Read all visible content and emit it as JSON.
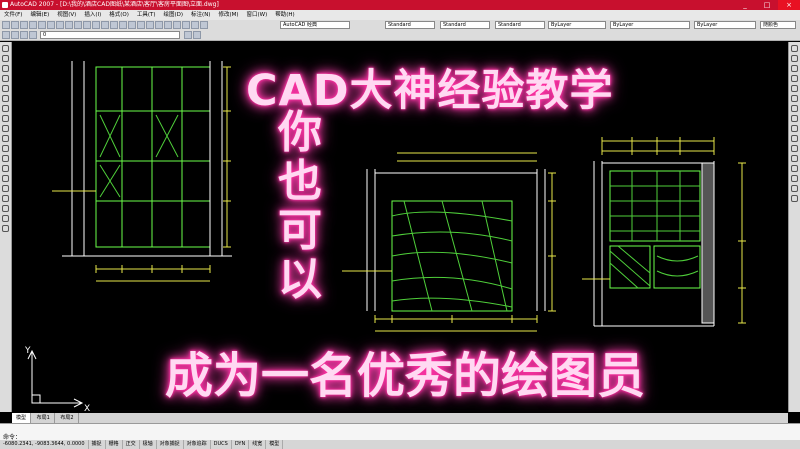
{
  "window": {
    "title": "AutoCAD 2007 - [D:\\我的\\酒店CAD图纸\\某酒店\\客厅\\客房平面图\\立面.dwg]",
    "minimize": "_",
    "maximize": "□",
    "close": "×"
  },
  "menu": [
    "文件(F)",
    "编辑(E)",
    "视图(V)",
    "插入(I)",
    "格式(O)",
    "工具(T)",
    "绘图(D)",
    "标注(N)",
    "修改(M)",
    "窗口(W)",
    "帮助(H)"
  ],
  "toolbar": {
    "workspace": "AutoCAD 经典",
    "text_style": "Standard",
    "dim_style": "Standard",
    "table_style": "Standard",
    "layer_color": "ByLayer",
    "linetype": "ByLayer",
    "lineweight": "ByLayer",
    "plot_style": "随颜色",
    "layer_name": "0"
  },
  "overlay": {
    "title": "CAD大神经验教学",
    "vertical": [
      "你",
      "也",
      "可",
      "以"
    ],
    "subtitle": "成为一名优秀的绘图员"
  },
  "ucs": {
    "x": "X",
    "y": "Y"
  },
  "tabs": [
    "模型",
    "布局1",
    "布局2"
  ],
  "command": {
    "label": "命令："
  },
  "status": {
    "coords": "-6080.2341, -9083.3644, 0.0000",
    "items": [
      "捕捉",
      "栅格",
      "正交",
      "极轴",
      "对象捕捉",
      "对象追踪",
      "DUCS",
      "DYN",
      "线宽",
      "模型"
    ]
  },
  "colors": {
    "title_bg": "#c8102e",
    "neon_glow": "#ff2fa0",
    "line_green": "#6aff4a",
    "dim_yellow": "#e8e84a",
    "wall_white": "#ffffff"
  }
}
